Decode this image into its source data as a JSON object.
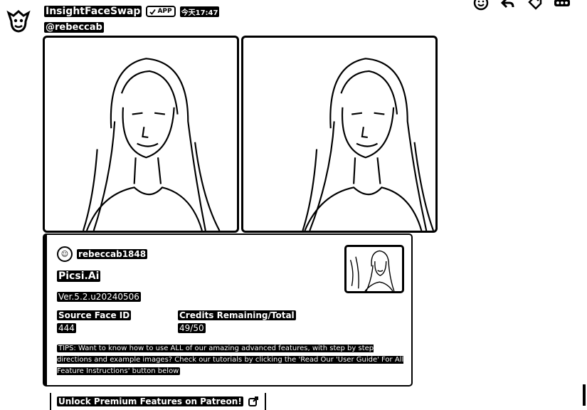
{
  "bot": {
    "name": "InsightFaceSwap",
    "badge": "APP",
    "timestamp": "今天17:47"
  },
  "message": {
    "mention": "@rebeccab"
  },
  "embed": {
    "author": "rebeccab1848",
    "title": "Picsi.Ai",
    "version": "Ver.5.2.u20240506",
    "fields": [
      {
        "name": "Source Face ID",
        "value": "444"
      },
      {
        "name": "Credits Remaining/Total",
        "value": "49/50"
      }
    ],
    "tips": "TIPS: Want to know how to use ALL of our amazing advanced features, with step by step directions and example images? Check our tutorials by clicking the 'Read Our 'User Guide' For All Feature Instructions' button below"
  },
  "button": {
    "label": "Unlock Premium Features on Patreon!"
  },
  "icons": {
    "bot_avatar": "bot-avatar-icon",
    "emoji": "emoji-icon",
    "reply": "reply-icon",
    "tag": "tag-icon",
    "more": "more-icon",
    "external_link": "external-link-icon"
  }
}
